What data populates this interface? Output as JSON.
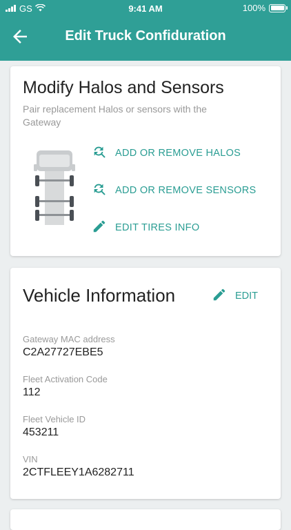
{
  "status": {
    "carrier": "GS",
    "time": "9:41 AM",
    "battery": "100%"
  },
  "header": {
    "title": "Edit Truck Confiduration"
  },
  "modify": {
    "title": "Modify Halos and Sensors",
    "subtitle": "Pair replacement Halos or sensors with the Gateway",
    "actions": [
      {
        "label": "ADD OR REMOVE HALOS",
        "icon": "refresh-search-icon"
      },
      {
        "label": "ADD OR REMOVE SENSORS",
        "icon": "refresh-search-icon"
      },
      {
        "label": "EDIT TIRES INFO",
        "icon": "pencil-icon"
      }
    ]
  },
  "vehicle": {
    "title": "Vehicle Information",
    "edit_label": "EDIT",
    "fields": [
      {
        "label": "Gateway MAC address",
        "value": "C2A27727EBE5"
      },
      {
        "label": "Fleet Activation Code",
        "value": "112"
      },
      {
        "label": "Fleet Vehicle ID",
        "value": "453211"
      },
      {
        "label": "VIN",
        "value": "2CTFLEEY1A6282711"
      }
    ]
  },
  "colors": {
    "primary": "#2f9f96",
    "accent": "#2a9d93",
    "background": "#eceff0"
  }
}
